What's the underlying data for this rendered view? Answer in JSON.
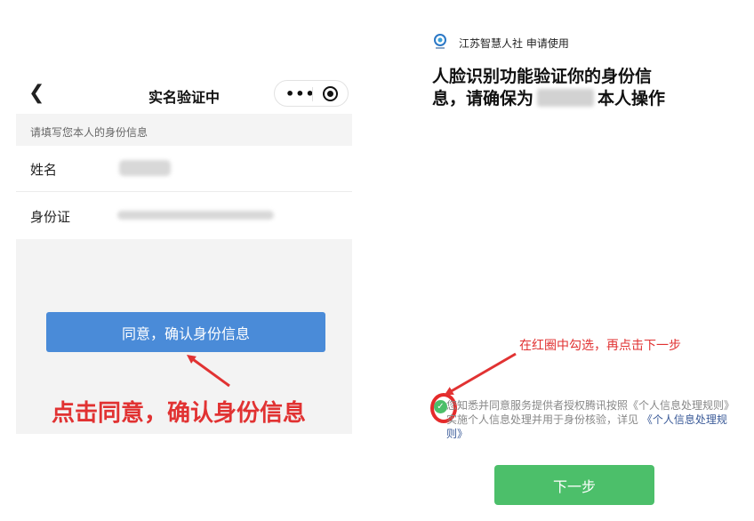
{
  "left": {
    "nav": {
      "back_icon": "chevron-left-icon",
      "title": "实名验证中",
      "more_icon": "more-dots-icon",
      "close_icon": "target-close-icon"
    },
    "hint": "请填写您本人的身份信息",
    "fields": [
      {
        "label": "姓名"
      },
      {
        "label": "身份证"
      }
    ],
    "confirm_button": "同意，确认身份信息",
    "annotation": "点击同意，确认身份信息",
    "colors": {
      "button": "#4a8bd8",
      "annotation": "#e13232",
      "background": "#f3f3f3"
    }
  },
  "right": {
    "app_name": "江苏智慧人社 申请使用",
    "title_line1": "人脸识别功能验证你的身份信",
    "title_line2_a": "息，请确保为",
    "title_line2_b": "本人操作",
    "annotation": "在红圈中勾选，再点击下一步",
    "consent_text": "您知悉并同意服务提供者授权腾讯按照《个人信息处理规则》实施个人信息处理并用于身份核验，详见",
    "consent_link": "《个人信息处理规则》",
    "checkbox_checked": true,
    "next_button": "下一步",
    "colors": {
      "accent_green": "#4cbf6a",
      "annotation": "#e13232",
      "link": "#3a5a98"
    }
  }
}
